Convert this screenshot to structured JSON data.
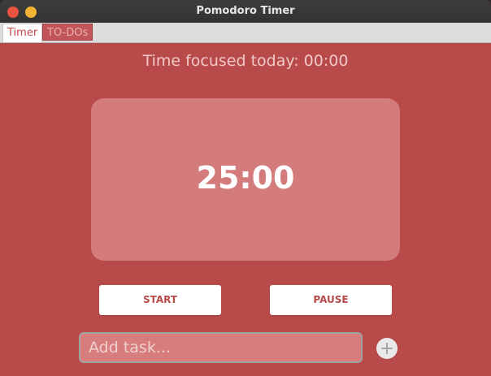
{
  "window": {
    "title": "Pomodoro Timer"
  },
  "tabs": [
    {
      "label": "Timer",
      "active": true
    },
    {
      "label": "TO-DOs",
      "active": false
    }
  ],
  "main": {
    "focus_label": "Time focused today: 00:00",
    "timer_value": "25:00",
    "start_label": "START",
    "pause_label": "PAUSE",
    "task_placeholder": "Add task...",
    "task_value": ""
  },
  "colors": {
    "background": "#b84a4a",
    "timer_card": "#d47b7b",
    "button": "#ffffff",
    "accent_text": "#f2c9c9"
  },
  "icons": {
    "close": "close-icon",
    "minimize": "minimize-icon",
    "add": "plus-icon"
  }
}
